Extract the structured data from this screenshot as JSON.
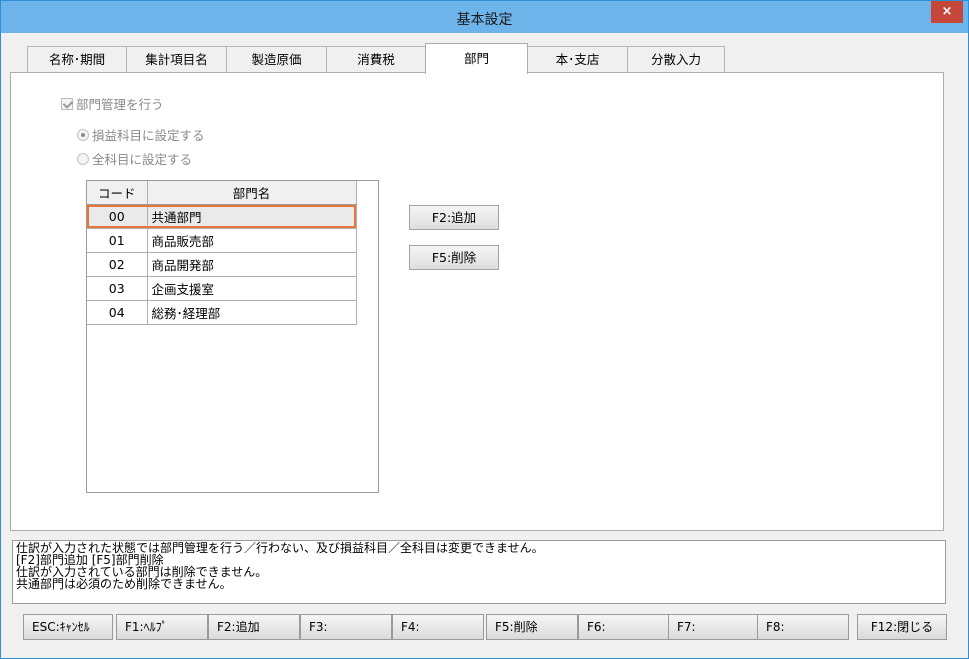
{
  "window": {
    "title": "基本設定",
    "close_glyph": "×"
  },
  "tabs": [
    {
      "label": "名称･期間"
    },
    {
      "label": "集計項目名"
    },
    {
      "label": "製造原価"
    },
    {
      "label": "消費税"
    },
    {
      "label": "部門"
    },
    {
      "label": "本･支店"
    },
    {
      "label": "分散入力"
    }
  ],
  "active_tab": "部門",
  "options": {
    "dept_manage": {
      "label": "部門管理を行う",
      "checked": true,
      "disabled": true
    },
    "radio_profit": {
      "label": "損益科目に設定する",
      "selected": true,
      "disabled": true
    },
    "radio_all": {
      "label": "全科目に設定する",
      "selected": false,
      "disabled": true
    }
  },
  "grid": {
    "headers": {
      "code": "コード",
      "name": "部門名"
    },
    "rows": [
      {
        "code": "00",
        "name": "共通部門"
      },
      {
        "code": "01",
        "name": "商品販売部"
      },
      {
        "code": "02",
        "name": "商品開発部"
      },
      {
        "code": "03",
        "name": "企画支援室"
      },
      {
        "code": "04",
        "name": "総務･経理部"
      }
    ],
    "selected_index": 0
  },
  "side_buttons": {
    "add": "F2:追加",
    "delete": "F5:削除"
  },
  "messages": [
    "仕訳が入力された状態では部門管理を行う／行わない、及び損益科目／全科目は変更できません。",
    "[F2]部門追加 [F5]部門削除",
    "仕訳が入力されている部門は削除できません。",
    "共通部門は必須のため削除できません。"
  ],
  "function_keys": [
    {
      "label": "ESC:ｷｬﾝｾﾙ"
    },
    {
      "label": "F1:ﾍﾙﾌﾟ"
    },
    {
      "label": "F2:追加"
    },
    {
      "label": "F3:"
    },
    {
      "label": "F4:"
    },
    {
      "label": "F5:削除"
    },
    {
      "label": "F6:"
    },
    {
      "label": "F7:"
    },
    {
      "label": "F8:"
    },
    {
      "label": "F12:閉じる"
    }
  ],
  "colors": {
    "titlebar": "#6cb4ea",
    "close": "#c7463a",
    "selection_border": "#e8763a"
  }
}
